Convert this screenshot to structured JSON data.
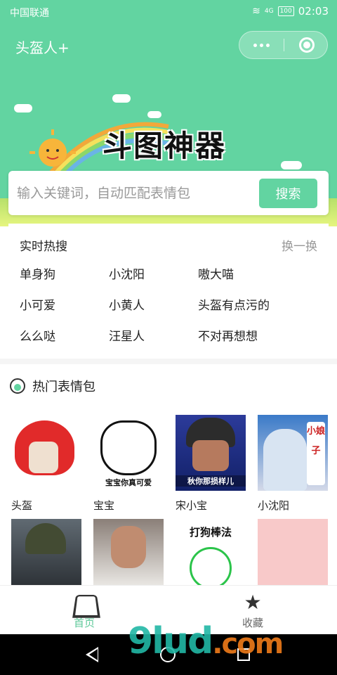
{
  "status_bar": {
    "carrier": "中国联通",
    "network": "4G",
    "battery": "100",
    "time": "02:03"
  },
  "header": {
    "title": "头盔人+"
  },
  "banner": {
    "title": "斗图神器"
  },
  "search": {
    "placeholder": "输入关键词，自动匹配表情包",
    "button_label": "搜索"
  },
  "hot_search": {
    "title": "实时热搜",
    "refresh_label": "换一换",
    "items": [
      "单身狗",
      "小沈阳",
      "嗷大喵",
      "小可爱",
      "小黄人",
      "头盔有点污的",
      "么么哒",
      "汪星人",
      "不对再想想"
    ]
  },
  "memes": {
    "title": "热门表情包",
    "items": [
      {
        "label": "头盔",
        "caption": ""
      },
      {
        "label": "宝宝",
        "caption": "宝宝你真可爱"
      },
      {
        "label": "宋小宝",
        "caption": "秋你那损样儿"
      },
      {
        "label": "小沈阳",
        "caption": "小娘子"
      },
      {
        "label": "",
        "caption": ""
      },
      {
        "label": "",
        "caption": ""
      },
      {
        "label": "",
        "caption": "打狗棒法"
      },
      {
        "label": "",
        "caption": ""
      }
    ]
  },
  "tabbar": {
    "home_label": "首页",
    "favorites_label": "收藏"
  },
  "watermark": {
    "brand": "9lud",
    "suffix": ".com"
  },
  "colors": {
    "primary": "#62d4a1",
    "active_tab": "#5fc99a"
  }
}
